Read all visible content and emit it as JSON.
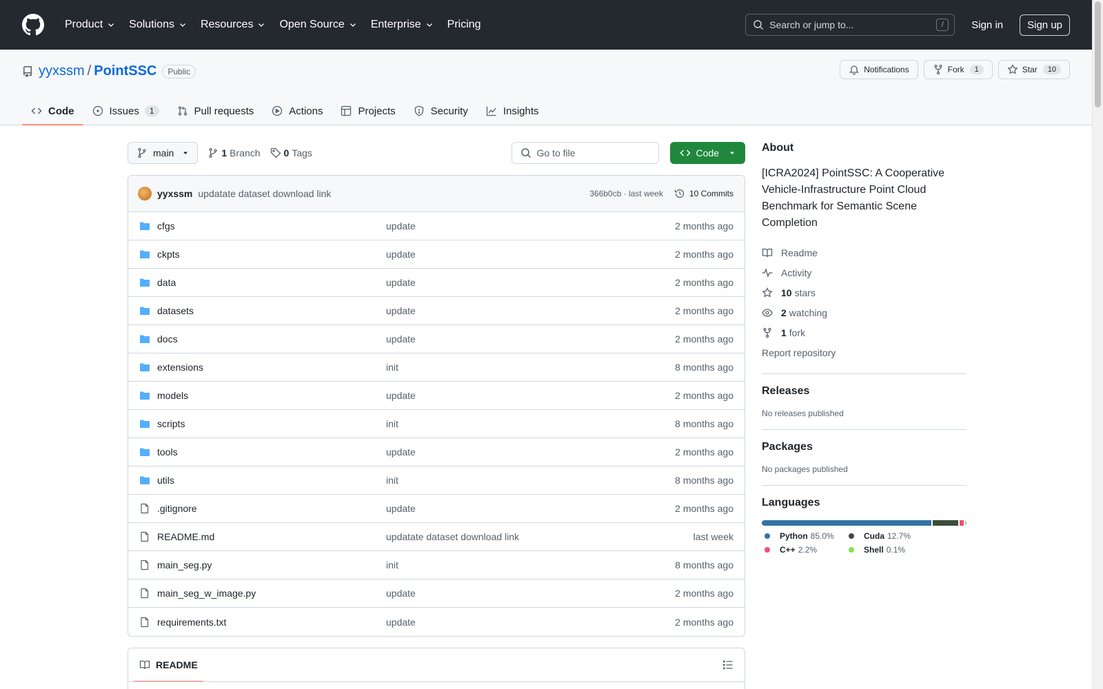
{
  "nav": {
    "items": [
      {
        "label": "Product",
        "dropdown": true
      },
      {
        "label": "Solutions",
        "dropdown": true
      },
      {
        "label": "Resources",
        "dropdown": true
      },
      {
        "label": "Open Source",
        "dropdown": true
      },
      {
        "label": "Enterprise",
        "dropdown": true
      },
      {
        "label": "Pricing",
        "dropdown": false
      }
    ],
    "search_placeholder": "Search or jump to...",
    "search_shortcut": "/",
    "sign_in": "Sign in",
    "sign_up": "Sign up"
  },
  "repo": {
    "owner": "yyxssm",
    "separator": "/",
    "name": "PointSSC",
    "visibility": "Public",
    "notifications_label": "Notifications",
    "fork_label": "Fork",
    "fork_count": "1",
    "star_label": "Star",
    "star_count": "10"
  },
  "tabs": {
    "code": "Code",
    "issues": "Issues",
    "issues_count": "1",
    "pull_requests": "Pull requests",
    "actions": "Actions",
    "projects": "Projects",
    "security": "Security",
    "insights": "Insights"
  },
  "branch_bar": {
    "branch": "main",
    "branch_count": "1",
    "branch_label": "Branch",
    "tag_count": "0",
    "tag_label": "Tags",
    "goto_placeholder": "Go to file",
    "code_button": "Code"
  },
  "latest_commit": {
    "author": "yyxssm",
    "message": "updatate dataset download link",
    "hash": "366b0cb",
    "time": "last week",
    "meta_sep": " · ",
    "commits_label": "10 Commits"
  },
  "files": [
    {
      "type": "dir",
      "name": "cfgs",
      "commit": "update",
      "age": "2 months ago"
    },
    {
      "type": "dir",
      "name": "ckpts",
      "commit": "update",
      "age": "2 months ago"
    },
    {
      "type": "dir",
      "name": "data",
      "commit": "update",
      "age": "2 months ago"
    },
    {
      "type": "dir",
      "name": "datasets",
      "commit": "update",
      "age": "2 months ago"
    },
    {
      "type": "dir",
      "name": "docs",
      "commit": "update",
      "age": "2 months ago"
    },
    {
      "type": "dir",
      "name": "extensions",
      "commit": "init",
      "age": "8 months ago"
    },
    {
      "type": "dir",
      "name": "models",
      "commit": "update",
      "age": "2 months ago"
    },
    {
      "type": "dir",
      "name": "scripts",
      "commit": "init",
      "age": "8 months ago"
    },
    {
      "type": "dir",
      "name": "tools",
      "commit": "update",
      "age": "2 months ago"
    },
    {
      "type": "dir",
      "name": "utils",
      "commit": "init",
      "age": "8 months ago"
    },
    {
      "type": "file",
      "name": ".gitignore",
      "commit": "update",
      "age": "2 months ago"
    },
    {
      "type": "file",
      "name": "README.md",
      "commit": "updatate dataset download link",
      "age": "last week"
    },
    {
      "type": "file",
      "name": "main_seg.py",
      "commit": "init",
      "age": "8 months ago"
    },
    {
      "type": "file",
      "name": "main_seg_w_image.py",
      "commit": "update",
      "age": "2 months ago"
    },
    {
      "type": "file",
      "name": "requirements.txt",
      "commit": "update",
      "age": "2 months ago"
    }
  ],
  "readme": {
    "tab_label": "README"
  },
  "about": {
    "heading": "About",
    "description": "[ICRA2024] PointSSC: A Cooperative Vehicle-Infrastructure Point Cloud Benchmark for Semantic Scene Completion",
    "readme": "Readme",
    "activity": "Activity",
    "stars_count": "10",
    "stars_label": "stars",
    "watching_count": "2",
    "watching_label": "watching",
    "fork_count": "1",
    "fork_label": "fork",
    "report": "Report repository"
  },
  "releases": {
    "heading": "Releases",
    "text": "No releases published"
  },
  "packages": {
    "heading": "Packages",
    "text": "No packages published"
  },
  "languages": {
    "heading": "Languages",
    "items": [
      {
        "name": "Python",
        "percent": "85.0%",
        "value": 85.0,
        "color": "#3572A5"
      },
      {
        "name": "Cuda",
        "percent": "12.7%",
        "value": 12.7,
        "color": "#3A4E3A"
      },
      {
        "name": "C++",
        "percent": "2.2%",
        "value": 2.2,
        "color": "#f34b7d"
      },
      {
        "name": "Shell",
        "percent": "0.1%",
        "value": 0.1,
        "color": "#89e051"
      }
    ]
  }
}
